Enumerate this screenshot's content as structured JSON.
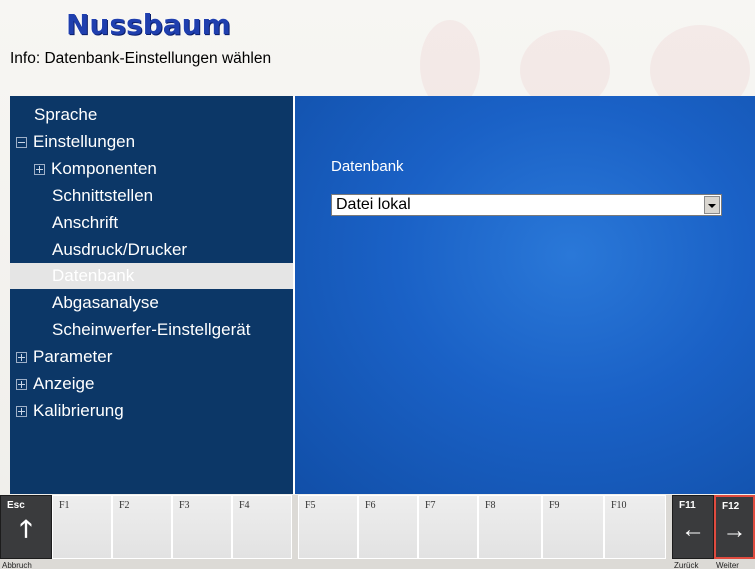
{
  "logo": {
    "text": "Nussbaum"
  },
  "info": {
    "text": "Info: Datenbank-Einstellungen wählen"
  },
  "tree": {
    "items": [
      {
        "label": "Sprache",
        "indent": 0,
        "expander": "none"
      },
      {
        "label": "Einstellungen",
        "indent": 0,
        "expander": "minus"
      },
      {
        "label": "Komponenten",
        "indent": 1,
        "expander": "plus"
      },
      {
        "label": "Schnittstellen",
        "indent": 1,
        "expander": "none"
      },
      {
        "label": "Anschrift",
        "indent": 1,
        "expander": "none"
      },
      {
        "label": "Ausdruck/Drucker",
        "indent": 1,
        "expander": "none"
      },
      {
        "label": "Datenbank",
        "indent": 1,
        "expander": "none",
        "selected": true
      },
      {
        "label": "Abgasanalyse",
        "indent": 1,
        "expander": "none"
      },
      {
        "label": "Scheinwerfer-Einstellgerät",
        "indent": 1,
        "expander": "none"
      },
      {
        "label": "Parameter",
        "indent": 0,
        "expander": "plus"
      },
      {
        "label": "Anzeige",
        "indent": 0,
        "expander": "plus"
      },
      {
        "label": "Kalibrierung",
        "indent": 0,
        "expander": "plus"
      }
    ]
  },
  "content": {
    "field_label": "Datenbank",
    "select_value": "Datei lokal"
  },
  "fkeys": [
    {
      "label": "Esc",
      "caption": "Abbruch",
      "icon": "arrow-up-icon",
      "glyph": "🡑",
      "dark": true
    },
    {
      "label": "F1"
    },
    {
      "label": "F2"
    },
    {
      "label": "F3"
    },
    {
      "label": "F4"
    },
    {
      "label": "F5"
    },
    {
      "label": "F6"
    },
    {
      "label": "F7"
    },
    {
      "label": "F8"
    },
    {
      "label": "F9"
    },
    {
      "label": "F10"
    },
    {
      "label": "F11",
      "caption": "Zurück",
      "icon": "arrow-left-icon",
      "glyph": "←",
      "dark": true
    },
    {
      "label": "F12",
      "caption": "Weiter",
      "icon": "arrow-right-icon",
      "glyph": "→",
      "dark": true,
      "accent": true
    }
  ],
  "colors": {
    "tree_bg": "#0c3767",
    "content_bg": "#1a61c6",
    "logo": "#1f3fae",
    "accent": "#e04b3f"
  }
}
